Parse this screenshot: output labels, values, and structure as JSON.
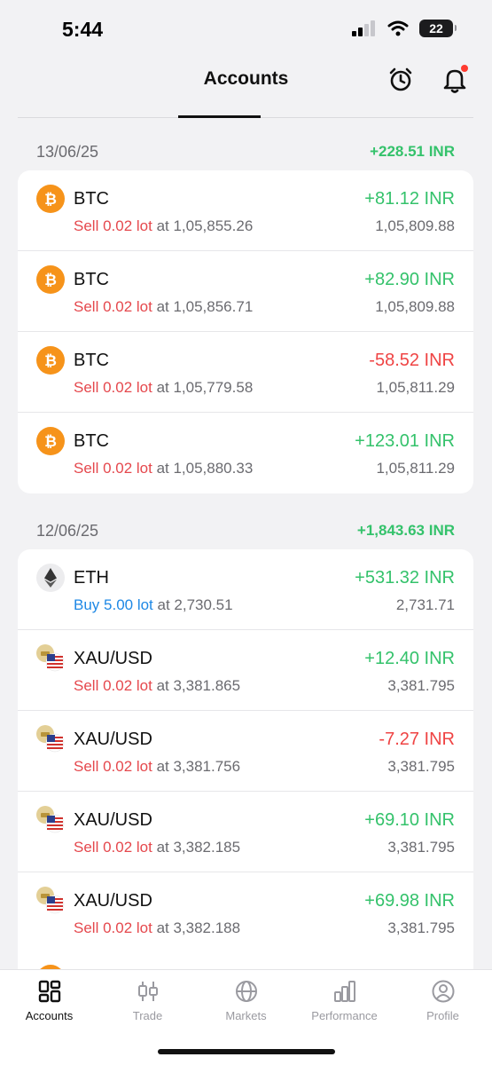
{
  "status_bar": {
    "time": "5:44",
    "battery": "22"
  },
  "header": {
    "title": "Accounts"
  },
  "groups": [
    {
      "date": "13/06/25",
      "total": "+228.51 INR",
      "trades": [
        {
          "symbol": "BTC",
          "side_text": "Sell 0.02 lot",
          "at_text": " at 1,05,855.26",
          "pnl": "+81.12 INR",
          "price": "1,05,809.88"
        },
        {
          "symbol": "BTC",
          "side_text": "Sell 0.02 lot",
          "at_text": " at 1,05,856.71",
          "pnl": "+82.90 INR",
          "price": "1,05,809.88"
        },
        {
          "symbol": "BTC",
          "side_text": "Sell 0.02 lot",
          "at_text": " at 1,05,779.58",
          "pnl": "-58.52 INR",
          "price": "1,05,811.29"
        },
        {
          "symbol": "BTC",
          "side_text": "Sell 0.02 lot",
          "at_text": " at 1,05,880.33",
          "pnl": "+123.01 INR",
          "price": "1,05,811.29"
        }
      ]
    },
    {
      "date": "12/06/25",
      "total": "+1,843.63 INR",
      "trades": [
        {
          "symbol": "ETH",
          "side_text": "Buy 5.00 lot",
          "at_text": " at 2,730.51",
          "pnl": "+531.32 INR",
          "price": "2,731.71"
        },
        {
          "symbol": "XAU/USD",
          "side_text": "Sell 0.02 lot",
          "at_text": " at 3,381.865",
          "pnl": "+12.40 INR",
          "price": "3,381.795"
        },
        {
          "symbol": "XAU/USD",
          "side_text": "Sell 0.02 lot",
          "at_text": " at 3,381.756",
          "pnl": "-7.27 INR",
          "price": "3,381.795"
        },
        {
          "symbol": "XAU/USD",
          "side_text": "Sell 0.02 lot",
          "at_text": " at 3,382.185",
          "pnl": "+69.10 INR",
          "price": "3,381.795"
        },
        {
          "symbol": "XAU/USD",
          "side_text": "Sell 0.02 lot",
          "at_text": " at 3,382.188",
          "pnl": "+69.98 INR",
          "price": "3,381.795"
        }
      ]
    }
  ],
  "colors": {
    "profit": "#34c26b",
    "loss": "#ef4444",
    "sell": "#e5484d",
    "buy": "#1e88e5",
    "btc": "#f6931a"
  },
  "nav": [
    {
      "label": "Accounts",
      "icon": "grid-icon",
      "active": true
    },
    {
      "label": "Trade",
      "icon": "candlestick-icon",
      "active": false
    },
    {
      "label": "Markets",
      "icon": "globe-icon",
      "active": false
    },
    {
      "label": "Performance",
      "icon": "bar-chart-icon",
      "active": false
    },
    {
      "label": "Profile",
      "icon": "user-icon",
      "active": false
    }
  ]
}
